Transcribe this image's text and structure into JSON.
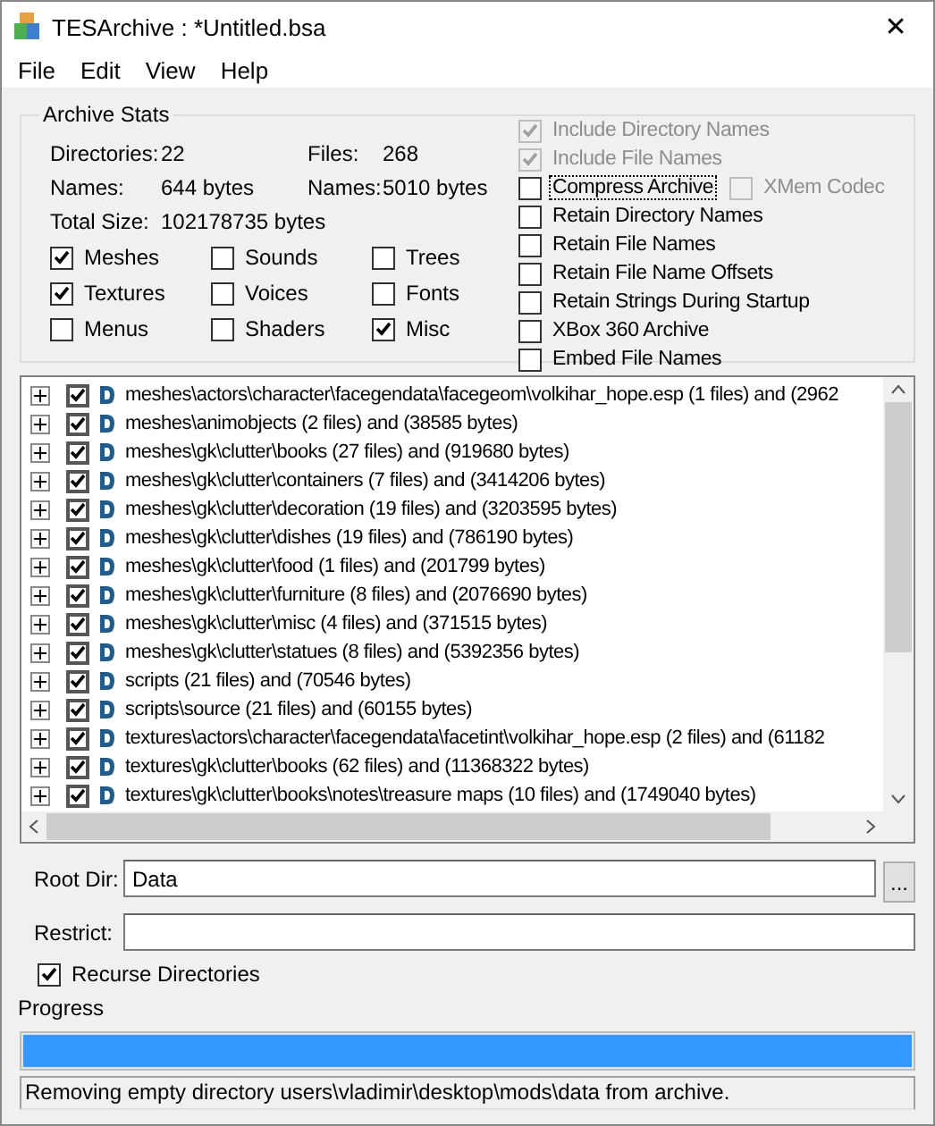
{
  "window": {
    "title": "TESArchive : *Untitled.bsa",
    "close": "✕"
  },
  "menu": [
    "File",
    "Edit",
    "View",
    "Help"
  ],
  "archive_stats": {
    "title": "Archive Stats",
    "stats": [
      {
        "label": "Directories:",
        "value": "22"
      },
      {
        "label": "Files:",
        "value": "268"
      },
      {
        "label": "Names:",
        "value": "644 bytes"
      },
      {
        "label": "Names:",
        "value": "5010 bytes"
      },
      {
        "label": "Total Size:",
        "value": "102178735 bytes"
      }
    ],
    "types": [
      {
        "label": "Meshes",
        "checked": true
      },
      {
        "label": "Sounds",
        "checked": false
      },
      {
        "label": "Trees",
        "checked": false
      },
      {
        "label": "Textures",
        "checked": true
      },
      {
        "label": "Voices",
        "checked": false
      },
      {
        "label": "Fonts",
        "checked": false
      },
      {
        "label": "Menus",
        "checked": false
      },
      {
        "label": "Shaders",
        "checked": false
      },
      {
        "label": "Misc",
        "checked": true
      }
    ],
    "options": [
      {
        "label": "Include Directory Names",
        "checked": true,
        "disabled": true,
        "focused": false
      },
      {
        "label": "Include File Names",
        "checked": true,
        "disabled": true,
        "focused": false
      },
      {
        "label": "Compress Archive",
        "checked": false,
        "disabled": false,
        "focused": true,
        "side": {
          "label": "XMem Codec",
          "checked": false,
          "disabled": true
        }
      },
      {
        "label": "Retain Directory Names",
        "checked": false,
        "disabled": false,
        "focused": false
      },
      {
        "label": "Retain File Names",
        "checked": false,
        "disabled": false,
        "focused": false
      },
      {
        "label": "Retain File Name Offsets",
        "checked": false,
        "disabled": false,
        "focused": false
      },
      {
        "label": "Retain Strings During Startup",
        "checked": false,
        "disabled": false,
        "focused": false
      },
      {
        "label": "XBox 360 Archive",
        "checked": false,
        "disabled": false,
        "focused": false
      },
      {
        "label": "Embed File Names",
        "checked": false,
        "disabled": false,
        "focused": false
      }
    ]
  },
  "tree": {
    "rows": [
      {
        "label": "meshes\\actors\\character\\facegendata\\facegeom\\volkihar_hope.esp (1 files) and (2962",
        "checked": true,
        "expanded": false
      },
      {
        "label": "meshes\\animobjects (2 files) and (38585 bytes)",
        "checked": true,
        "expanded": false
      },
      {
        "label": "meshes\\gk\\clutter\\books (27 files) and (919680 bytes)",
        "checked": true,
        "expanded": false
      },
      {
        "label": "meshes\\gk\\clutter\\containers (7 files) and (3414206 bytes)",
        "checked": true,
        "expanded": false
      },
      {
        "label": "meshes\\gk\\clutter\\decoration (19 files) and (3203595 bytes)",
        "checked": true,
        "expanded": false
      },
      {
        "label": "meshes\\gk\\clutter\\dishes (19 files) and (786190 bytes)",
        "checked": true,
        "expanded": false
      },
      {
        "label": "meshes\\gk\\clutter\\food (1 files) and (201799 bytes)",
        "checked": true,
        "expanded": false
      },
      {
        "label": "meshes\\gk\\clutter\\furniture (8 files) and (2076690 bytes)",
        "checked": true,
        "expanded": false
      },
      {
        "label": "meshes\\gk\\clutter\\misc (4 files) and (371515 bytes)",
        "checked": true,
        "expanded": false
      },
      {
        "label": "meshes\\gk\\clutter\\statues (8 files) and (5392356 bytes)",
        "checked": true,
        "expanded": false
      },
      {
        "label": "scripts (21 files) and (70546 bytes)",
        "checked": true,
        "expanded": false
      },
      {
        "label": "scripts\\source (21 files) and (60155 bytes)",
        "checked": true,
        "expanded": false
      },
      {
        "label": "textures\\actors\\character\\facegendata\\facetint\\volkihar_hope.esp (2 files) and (61182",
        "checked": true,
        "expanded": false
      },
      {
        "label": "textures\\gk\\clutter\\books (62 files) and (11368322 bytes)",
        "checked": true,
        "expanded": false
      },
      {
        "label": "textures\\gk\\clutter\\books\\notes\\treasure maps (10 files) and (1749040 bytes)",
        "checked": true,
        "expanded": false
      }
    ]
  },
  "root_dir": {
    "label": "Root Dir:",
    "value": "Data",
    "browse": "..."
  },
  "restrict": {
    "label": "Restrict:"
  },
  "recurse": {
    "label": "Recurse Directories",
    "checked": true
  },
  "progress": {
    "label": "Progress",
    "level": 1
  },
  "status": "Removing empty directory users\\vladimir\\desktop\\mods\\data from archive."
}
